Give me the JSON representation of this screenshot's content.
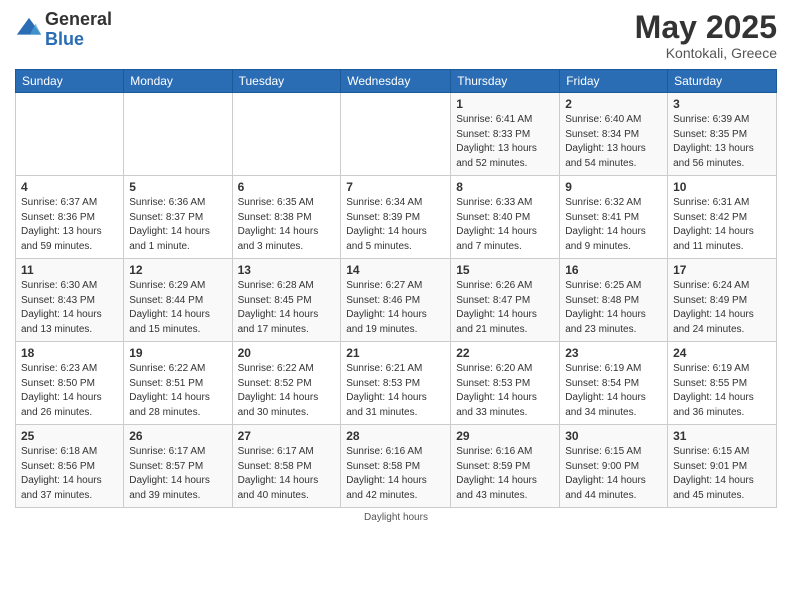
{
  "logo": {
    "general": "General",
    "blue": "Blue"
  },
  "header": {
    "month": "May 2025",
    "location": "Kontokali, Greece"
  },
  "weekdays": [
    "Sunday",
    "Monday",
    "Tuesday",
    "Wednesday",
    "Thursday",
    "Friday",
    "Saturday"
  ],
  "footer": {
    "note": "Daylight hours"
  },
  "weeks": [
    [
      {
        "day": "",
        "info": ""
      },
      {
        "day": "",
        "info": ""
      },
      {
        "day": "",
        "info": ""
      },
      {
        "day": "",
        "info": ""
      },
      {
        "day": "1",
        "info": "Sunrise: 6:41 AM\nSunset: 8:33 PM\nDaylight: 13 hours\nand 52 minutes."
      },
      {
        "day": "2",
        "info": "Sunrise: 6:40 AM\nSunset: 8:34 PM\nDaylight: 13 hours\nand 54 minutes."
      },
      {
        "day": "3",
        "info": "Sunrise: 6:39 AM\nSunset: 8:35 PM\nDaylight: 13 hours\nand 56 minutes."
      }
    ],
    [
      {
        "day": "4",
        "info": "Sunrise: 6:37 AM\nSunset: 8:36 PM\nDaylight: 13 hours\nand 59 minutes."
      },
      {
        "day": "5",
        "info": "Sunrise: 6:36 AM\nSunset: 8:37 PM\nDaylight: 14 hours\nand 1 minute."
      },
      {
        "day": "6",
        "info": "Sunrise: 6:35 AM\nSunset: 8:38 PM\nDaylight: 14 hours\nand 3 minutes."
      },
      {
        "day": "7",
        "info": "Sunrise: 6:34 AM\nSunset: 8:39 PM\nDaylight: 14 hours\nand 5 minutes."
      },
      {
        "day": "8",
        "info": "Sunrise: 6:33 AM\nSunset: 8:40 PM\nDaylight: 14 hours\nand 7 minutes."
      },
      {
        "day": "9",
        "info": "Sunrise: 6:32 AM\nSunset: 8:41 PM\nDaylight: 14 hours\nand 9 minutes."
      },
      {
        "day": "10",
        "info": "Sunrise: 6:31 AM\nSunset: 8:42 PM\nDaylight: 14 hours\nand 11 minutes."
      }
    ],
    [
      {
        "day": "11",
        "info": "Sunrise: 6:30 AM\nSunset: 8:43 PM\nDaylight: 14 hours\nand 13 minutes."
      },
      {
        "day": "12",
        "info": "Sunrise: 6:29 AM\nSunset: 8:44 PM\nDaylight: 14 hours\nand 15 minutes."
      },
      {
        "day": "13",
        "info": "Sunrise: 6:28 AM\nSunset: 8:45 PM\nDaylight: 14 hours\nand 17 minutes."
      },
      {
        "day": "14",
        "info": "Sunrise: 6:27 AM\nSunset: 8:46 PM\nDaylight: 14 hours\nand 19 minutes."
      },
      {
        "day": "15",
        "info": "Sunrise: 6:26 AM\nSunset: 8:47 PM\nDaylight: 14 hours\nand 21 minutes."
      },
      {
        "day": "16",
        "info": "Sunrise: 6:25 AM\nSunset: 8:48 PM\nDaylight: 14 hours\nand 23 minutes."
      },
      {
        "day": "17",
        "info": "Sunrise: 6:24 AM\nSunset: 8:49 PM\nDaylight: 14 hours\nand 24 minutes."
      }
    ],
    [
      {
        "day": "18",
        "info": "Sunrise: 6:23 AM\nSunset: 8:50 PM\nDaylight: 14 hours\nand 26 minutes."
      },
      {
        "day": "19",
        "info": "Sunrise: 6:22 AM\nSunset: 8:51 PM\nDaylight: 14 hours\nand 28 minutes."
      },
      {
        "day": "20",
        "info": "Sunrise: 6:22 AM\nSunset: 8:52 PM\nDaylight: 14 hours\nand 30 minutes."
      },
      {
        "day": "21",
        "info": "Sunrise: 6:21 AM\nSunset: 8:53 PM\nDaylight: 14 hours\nand 31 minutes."
      },
      {
        "day": "22",
        "info": "Sunrise: 6:20 AM\nSunset: 8:53 PM\nDaylight: 14 hours\nand 33 minutes."
      },
      {
        "day": "23",
        "info": "Sunrise: 6:19 AM\nSunset: 8:54 PM\nDaylight: 14 hours\nand 34 minutes."
      },
      {
        "day": "24",
        "info": "Sunrise: 6:19 AM\nSunset: 8:55 PM\nDaylight: 14 hours\nand 36 minutes."
      }
    ],
    [
      {
        "day": "25",
        "info": "Sunrise: 6:18 AM\nSunset: 8:56 PM\nDaylight: 14 hours\nand 37 minutes."
      },
      {
        "day": "26",
        "info": "Sunrise: 6:17 AM\nSunset: 8:57 PM\nDaylight: 14 hours\nand 39 minutes."
      },
      {
        "day": "27",
        "info": "Sunrise: 6:17 AM\nSunset: 8:58 PM\nDaylight: 14 hours\nand 40 minutes."
      },
      {
        "day": "28",
        "info": "Sunrise: 6:16 AM\nSunset: 8:58 PM\nDaylight: 14 hours\nand 42 minutes."
      },
      {
        "day": "29",
        "info": "Sunrise: 6:16 AM\nSunset: 8:59 PM\nDaylight: 14 hours\nand 43 minutes."
      },
      {
        "day": "30",
        "info": "Sunrise: 6:15 AM\nSunset: 9:00 PM\nDaylight: 14 hours\nand 44 minutes."
      },
      {
        "day": "31",
        "info": "Sunrise: 6:15 AM\nSunset: 9:01 PM\nDaylight: 14 hours\nand 45 minutes."
      }
    ]
  ]
}
